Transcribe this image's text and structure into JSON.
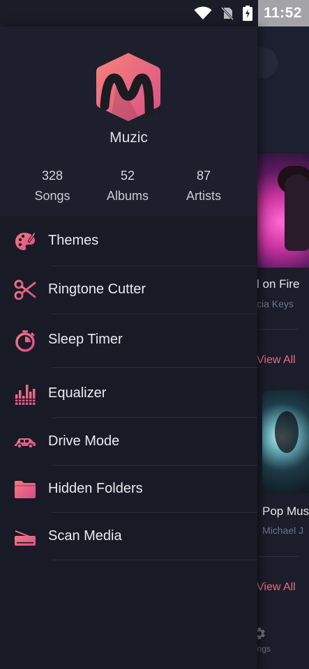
{
  "status_bar": {
    "time": "11:52",
    "icons": [
      "wifi-icon",
      "no-sim-icon",
      "battery-charging-icon"
    ]
  },
  "drawer": {
    "app_name": "Muzic",
    "stats": [
      {
        "value": "328",
        "label": "Songs"
      },
      {
        "value": "52",
        "label": "Albums"
      },
      {
        "value": "87",
        "label": "Artists"
      }
    ],
    "menu": [
      {
        "label": "Themes",
        "icon": "palette-icon"
      },
      {
        "label": "Ringtone Cutter",
        "icon": "scissors-icon"
      },
      {
        "label": "Sleep Timer",
        "icon": "stopwatch-icon"
      },
      {
        "label": "Equalizer",
        "icon": "equalizer-icon"
      },
      {
        "label": "Drive Mode",
        "icon": "car-icon"
      },
      {
        "label": "Hidden Folders",
        "icon": "folder-icon"
      },
      {
        "label": "Scan Media",
        "icon": "scanner-icon"
      }
    ]
  },
  "background": {
    "song_title": "l on Fire",
    "song_artist": "cia Keys",
    "view_all_1": "View All",
    "pop_title": "Pop Mus",
    "pop_artist": "Michael J",
    "view_all_2": "View All",
    "settings_label": "ings"
  },
  "colors": {
    "accent": "#e46f7d",
    "drawer_bg": "#181a26",
    "header_bg": "#1d1f2d",
    "icon_gradient_start": "#f06e7e",
    "icon_gradient_end": "#d94f8a"
  }
}
